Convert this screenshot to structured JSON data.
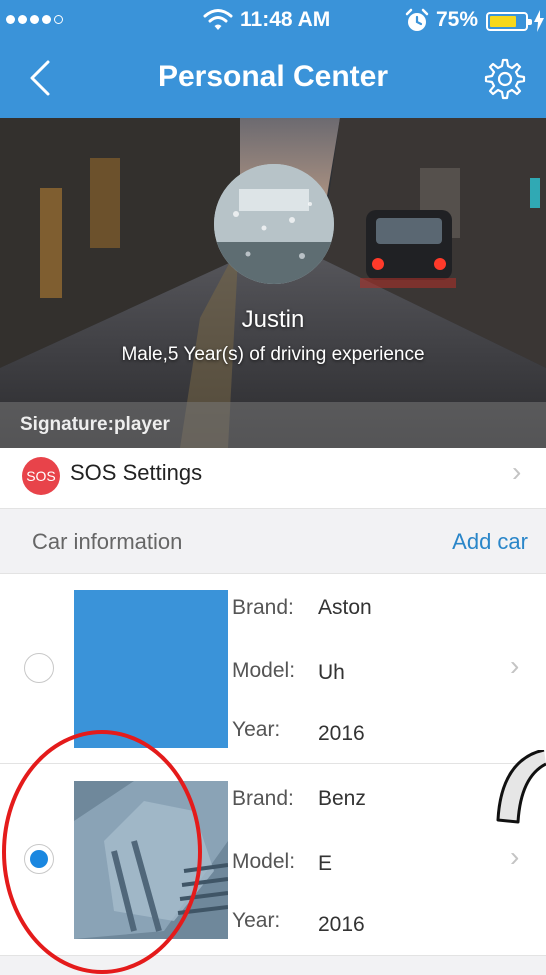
{
  "status_bar": {
    "time": "11:48 AM",
    "battery_percent": "75%",
    "battery_level": 0.75,
    "battery_color": "#f7d81b",
    "signal_bars_filled": 4,
    "signal_bars_total": 5,
    "icons": [
      "signal-dots-icon",
      "wifi-icon",
      "alarm-clock-icon",
      "battery-icon",
      "charging-bolt-icon"
    ]
  },
  "nav": {
    "title": "Personal Center",
    "back_icon": "chevron-left-icon",
    "settings_icon": "gear-icon",
    "bar_color": "#3a93d9"
  },
  "profile": {
    "name": "Justin",
    "details": "Male,5 Year(s) of driving experience",
    "signature": "Signature:player"
  },
  "sos": {
    "badge": "SOS",
    "label": "SOS Settings",
    "badge_color": "#e8434a"
  },
  "car_section": {
    "title": "Car information",
    "add_label": "Add car",
    "link_color": "#2a86c9"
  },
  "cars": [
    {
      "selected": false,
      "brand_label": "Brand:",
      "brand": "Aston",
      "model_label": "Model:",
      "model": "Uh",
      "year_label": "Year:",
      "year": "2016"
    },
    {
      "selected": true,
      "brand_label": "Brand:",
      "brand": "Benz",
      "model_label": "Model:",
      "model": "E",
      "year_label": "Year:",
      "year": "2016"
    }
  ],
  "annotation_color": "#e41b1b",
  "radio_selected_color": "#1a87e0"
}
